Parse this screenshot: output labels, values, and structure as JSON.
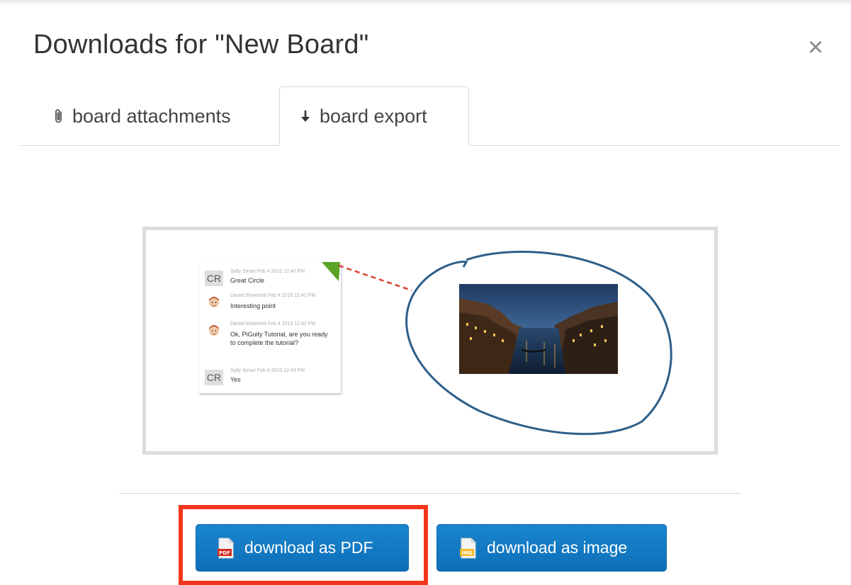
{
  "dialog": {
    "title": "Downloads for \"New Board\"",
    "close_label": "×"
  },
  "tabs": [
    {
      "label": "board attachments",
      "icon": "paperclip-icon",
      "active": false
    },
    {
      "label": "board export",
      "icon": "arrow-down-icon",
      "active": true
    }
  ],
  "preview": {
    "chat": [
      {
        "avatar": "CR",
        "meta": "Sally Smart Feb 4 2015 12:40 PM",
        "text": "Great Circle"
      },
      {
        "avatar": "face",
        "meta": "Daniel Brownetti Feb 4 2015 12:41 PM",
        "text": "Interesting point"
      },
      {
        "avatar": "face",
        "meta": "Daniel Brownetti Feb 4 2015 12:42 PM",
        "text": "Ok, PiGuity Tutorial, are you ready to complete the tutorial?"
      },
      {
        "avatar": "CR",
        "meta": "Sally Smart Feb 4 2015 12:43 PM",
        "text": "Yes"
      }
    ],
    "colors": {
      "circle": "#2d5f8a",
      "dashed_line": "#d9453b",
      "pin": "#5aa324"
    }
  },
  "buttons": {
    "pdf": {
      "label": "download as PDF",
      "badge": "PDF"
    },
    "image": {
      "label": "download as image",
      "badge": "IMG"
    }
  },
  "colors": {
    "button": "#1479c4",
    "highlight": "#f2361d"
  }
}
